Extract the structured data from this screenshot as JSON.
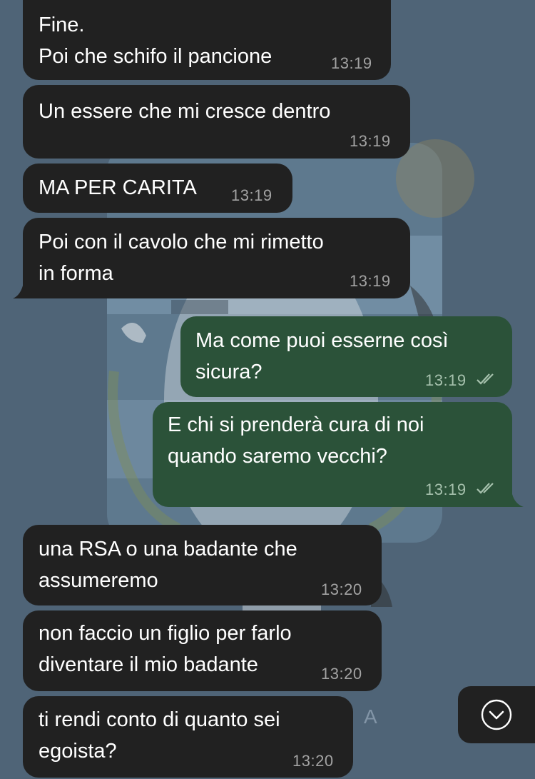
{
  "messages": [
    {
      "direction": "incoming",
      "text": "Fine.\nPoi che schifo il pancione",
      "time": "13:19"
    },
    {
      "direction": "incoming",
      "text": "Un essere che mi cresce dentro",
      "time": "13:19"
    },
    {
      "direction": "incoming",
      "text": "MA PER CARITA",
      "time": "13:19"
    },
    {
      "direction": "incoming",
      "text": "Poi con il cavolo che mi rimetto\nin forma",
      "time": "13:19"
    },
    {
      "direction": "outgoing",
      "text": "Ma come puoi esserne così\nsicura?",
      "time": "13:19",
      "status": "read"
    },
    {
      "direction": "outgoing",
      "text": "E chi si prenderà cura di noi\nquando saremo vecchi?",
      "time": "13:19",
      "status": "read"
    },
    {
      "direction": "incoming",
      "text": "una RSA o una badante che\nassumeremo",
      "time": "13:20"
    },
    {
      "direction": "incoming",
      "text": "non faccio un figlio per farlo\ndiventare il mio badante",
      "time": "13:20"
    },
    {
      "direction": "incoming",
      "text": "ti rendi conto di quanto sei\negoista?",
      "time": "13:20"
    }
  ],
  "scroll_button": {
    "icon": "chevron-down-circle-icon"
  },
  "wallpaper": {
    "watermark_letter": "A"
  },
  "colors": {
    "background": "#4f6477",
    "incoming_bubble": "#212121",
    "outgoing_bubble": "#2b5239",
    "text": "#ffffff",
    "incoming_time": "#a3a3a3",
    "outgoing_time": "#a6c1ad"
  }
}
